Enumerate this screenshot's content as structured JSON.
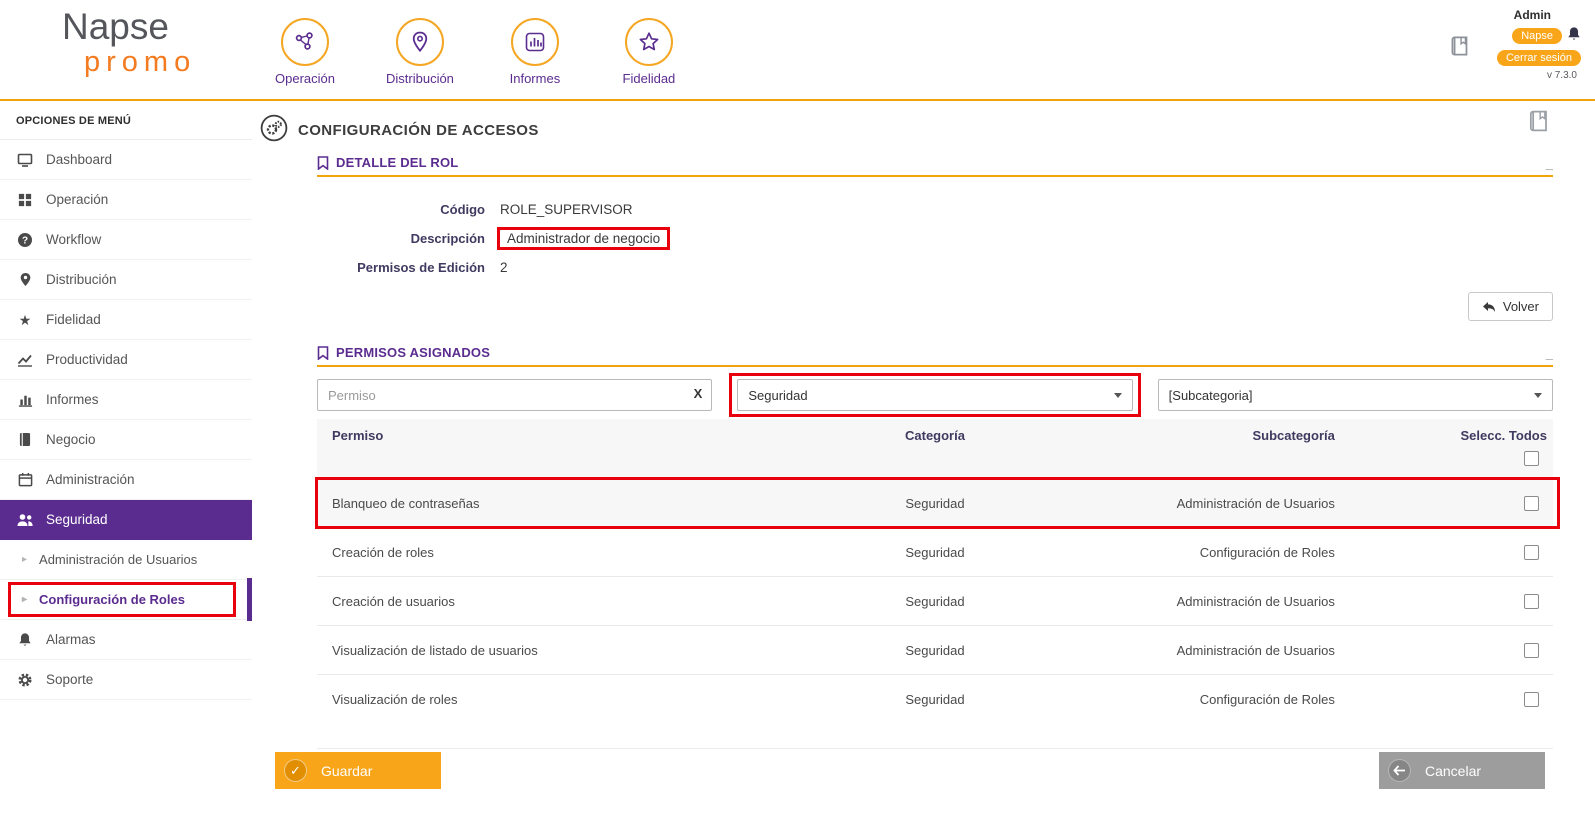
{
  "header": {
    "logo_line1": "Napse",
    "logo_line2": "promo",
    "nav": [
      {
        "label": "Operación",
        "icon": "operation-network-icon"
      },
      {
        "label": "Distribución",
        "icon": "distribution-pin-icon"
      },
      {
        "label": "Informes",
        "icon": "reports-barchart-icon"
      },
      {
        "label": "Fidelidad",
        "icon": "loyalty-star-icon"
      }
    ],
    "user": {
      "name": "Admin",
      "badge": "Napse",
      "logout_label": "Cerrar sesión",
      "version": "v 7.3.0"
    }
  },
  "sidebar": {
    "title": "OPCIONES DE MENÚ",
    "items": [
      {
        "label": "Dashboard",
        "icon": "monitor-icon"
      },
      {
        "label": "Operación",
        "icon": "grid-icon"
      },
      {
        "label": "Workflow",
        "icon": "question-circle-icon"
      },
      {
        "label": "Distribución",
        "icon": "pin-icon"
      },
      {
        "label": "Fidelidad",
        "icon": "star-icon"
      },
      {
        "label": "Productividad",
        "icon": "line-chart-icon"
      },
      {
        "label": "Informes",
        "icon": "bar-chart-icon"
      },
      {
        "label": "Negocio",
        "icon": "book-icon"
      },
      {
        "label": "Administración",
        "icon": "calendar-icon"
      },
      {
        "label": "Seguridad",
        "icon": "users-icon",
        "active": true
      },
      {
        "label": "Administración de Usuarios",
        "sub": true
      },
      {
        "label": "Configuración de Roles",
        "sub": true,
        "annotated": true
      },
      {
        "label": "Alarmas",
        "icon": "bell-icon"
      },
      {
        "label": "Soporte",
        "icon": "gear-icon"
      }
    ]
  },
  "page": {
    "title": "CONFIGURACIÓN DE ACCESOS"
  },
  "role_detail": {
    "section_title": "DETALLE DEL ROL",
    "minimize_label": "_",
    "fields": [
      {
        "label": "Código",
        "value": "ROLE_SUPERVISOR"
      },
      {
        "label": "Descripción",
        "value": "Administrador de negocio",
        "annotated": true
      },
      {
        "label": "Permisos de Edición",
        "value": "2"
      }
    ],
    "back_button_label": "Volver"
  },
  "permissions": {
    "section_title": "PERMISOS ASIGNADOS",
    "minimize_label": "_",
    "filters": {
      "permiso_placeholder": "Permiso",
      "clear_label": "X",
      "categoria_selected": "Seguridad",
      "categoria_annotated": true,
      "subcategoria_selected": "[Subcategoria]"
    },
    "table": {
      "headers": {
        "permiso": "Permiso",
        "categoria": "Categoría",
        "subcategoria": "Subcategoría",
        "select_all": "Selecc. Todos"
      },
      "rows": [
        {
          "permiso": "Blanqueo de contraseñas",
          "categoria": "Seguridad",
          "subcategoria": "Administración de Usuarios",
          "checked": false,
          "annotated": true
        },
        {
          "permiso": "Creación de roles",
          "categoria": "Seguridad",
          "subcategoria": "Configuración de Roles",
          "checked": false
        },
        {
          "permiso": "Creación de usuarios",
          "categoria": "Seguridad",
          "subcategoria": "Administración de Usuarios",
          "checked": false
        },
        {
          "permiso": "Visualización de listado de usuarios",
          "categoria": "Seguridad",
          "subcategoria": "Administración de Usuarios",
          "checked": false
        },
        {
          "permiso": "Visualización de roles",
          "categoria": "Seguridad",
          "subcategoria": "Configuración de Roles",
          "checked": false
        }
      ]
    }
  },
  "actions": {
    "save_label": "Guardar",
    "cancel_label": "Cancelar"
  },
  "annotations": {
    "highlight_color": "#e8000d",
    "highlights": [
      "sidebar-item-configuracion-de-roles",
      "descripcion-value",
      "categoria-select",
      "table-row-blanqueo-de-contrasenas"
    ]
  },
  "colors": {
    "purple": "#5b2c8f",
    "orange": "#f9a51a",
    "orange_line": "#f0a30a",
    "annotation_red": "#e8000d"
  }
}
